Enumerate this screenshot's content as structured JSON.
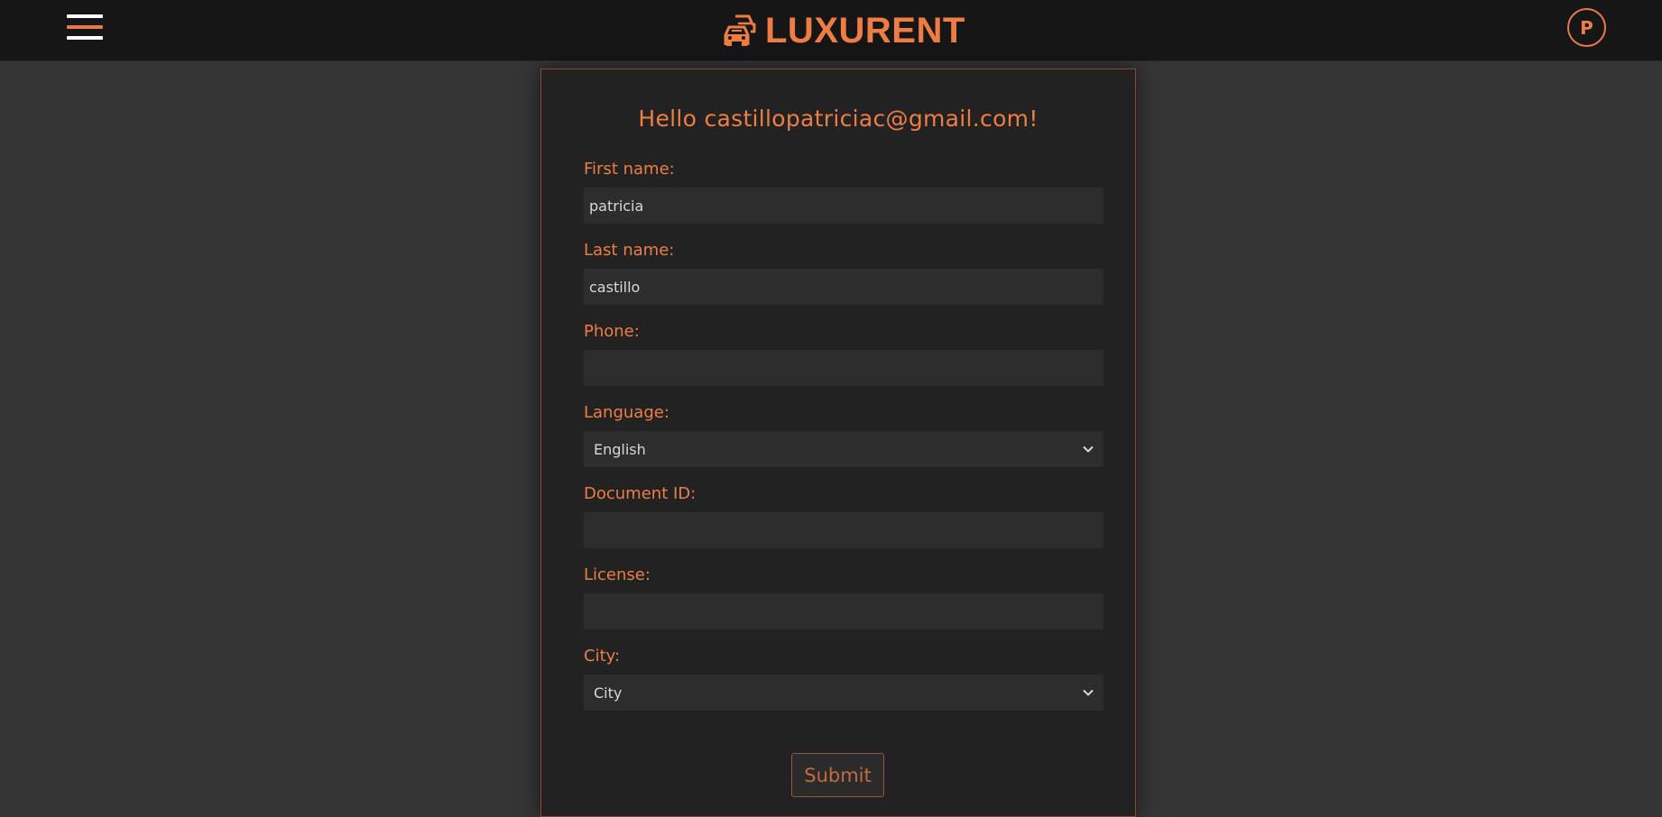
{
  "header": {
    "brand_name": "LUXURENT",
    "brand_icon": "cars-icon",
    "avatar_initial": "P",
    "accent_color": "#ee7d44"
  },
  "form": {
    "greeting": "Hello castillopatriciac@gmail.com!",
    "first_name": {
      "label": "First name:",
      "value": "patricia"
    },
    "last_name": {
      "label": "Last name:",
      "value": "castillo"
    },
    "phone": {
      "label": "Phone:",
      "value": ""
    },
    "language": {
      "label": "Language:",
      "selected": "English"
    },
    "document_id": {
      "label": "Document ID:",
      "value": ""
    },
    "license": {
      "label": "License:",
      "value": ""
    },
    "city": {
      "label": "City:",
      "selected": "City"
    },
    "submit_label": "Submit"
  }
}
